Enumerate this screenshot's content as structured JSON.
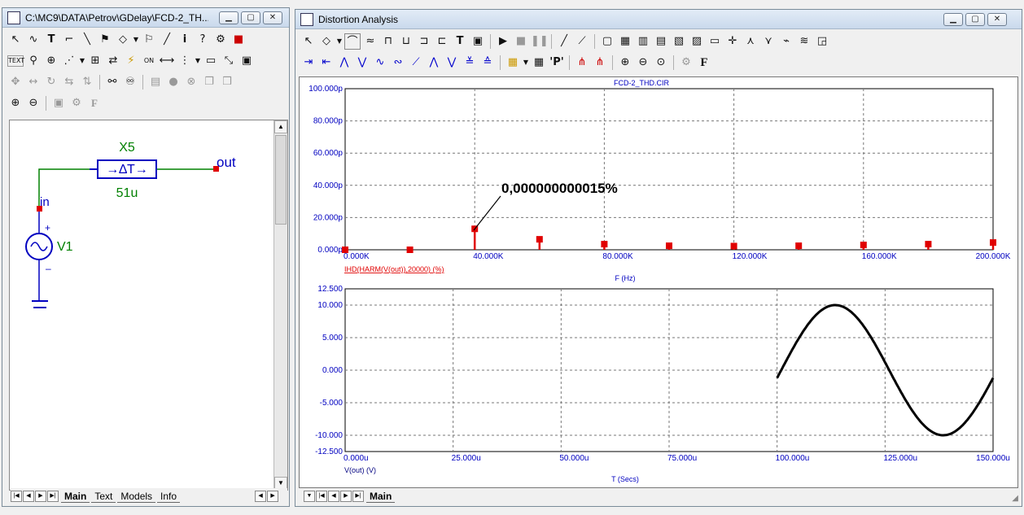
{
  "left_window": {
    "title": "C:\\MC9\\DATA\\Petrov\\GDelay\\FCD-2_TH...",
    "schematic": {
      "part_name": "X5",
      "part_symbol": "→∆T→",
      "part_value": "51u",
      "net_in": "in",
      "net_out": "out",
      "source_name": "V1"
    },
    "tabs": [
      "Main",
      "Text",
      "Models",
      "Info"
    ],
    "active_tab": "Main"
  },
  "right_window": {
    "title": "Distortion Analysis",
    "tabs": [
      "Main"
    ],
    "active_tab": "Main",
    "plot_title": "FCD-2_THD.CIR",
    "annotation": "0,000000000015%",
    "trace1_label": "IHD(HARM(V(out)),20000) (%)",
    "trace2_label": "V(out) (V)",
    "xlabel1": "F (Hz)",
    "xlabel2": "T (Secs)"
  },
  "chart_data": [
    {
      "type": "scatter",
      "title": "FCD-2_THD.CIR",
      "xlabel": "F (Hz)",
      "ylabel": "IHD(HARM(V(out)),20000) (%)",
      "xlim": [
        0,
        200000
      ],
      "ylim": [
        0,
        1e-10
      ],
      "x_tick_labels": [
        "0.000K",
        "40.000K",
        "80.000K",
        "120.000K",
        "160.000K",
        "200.000K"
      ],
      "y_tick_labels": [
        "0.000p",
        "20.000p",
        "40.000p",
        "60.000p",
        "80.000p",
        "100.000p"
      ],
      "grid": true,
      "color": "#e00000",
      "series": [
        {
          "name": "IHD(HARM(V(out)),20000) (%)",
          "x": [
            0,
            20000,
            40000,
            60000,
            80000,
            100000,
            120000,
            140000,
            160000,
            180000,
            200000
          ],
          "y": [
            0,
            0,
            1.3e-11,
            6.5e-12,
            3.5e-12,
            2.5e-12,
            2.3e-12,
            2.5e-12,
            3e-12,
            3.5e-12,
            4.5e-12
          ]
        }
      ],
      "annotations": [
        {
          "text": "0,000000000015%",
          "x": 40000,
          "y": 1.3e-11
        }
      ]
    },
    {
      "type": "line",
      "xlabel": "T (Secs)",
      "ylabel": "V(out) (V)",
      "xlim": [
        0,
        0.00015
      ],
      "ylim": [
        -12.5,
        12.5
      ],
      "x_tick_labels": [
        "0.000u",
        "25.000u",
        "50.000u",
        "75.000u",
        "100.000u",
        "125.000u",
        "150.000u"
      ],
      "y_tick_labels": [
        "12.500",
        "10.000",
        "5.000",
        "0.000",
        "-5.000",
        "-10.000",
        "-12.500"
      ],
      "grid": true,
      "color": "#000000",
      "series": [
        {
          "name": "V(out) (V)",
          "function": "10*sin(2*pi*20000*(t-100u)+phase)",
          "t_start": 0.0001,
          "t_end": 0.00015,
          "amplitude": 10,
          "frequency": 20000,
          "start_value": -1.2
        }
      ]
    }
  ]
}
